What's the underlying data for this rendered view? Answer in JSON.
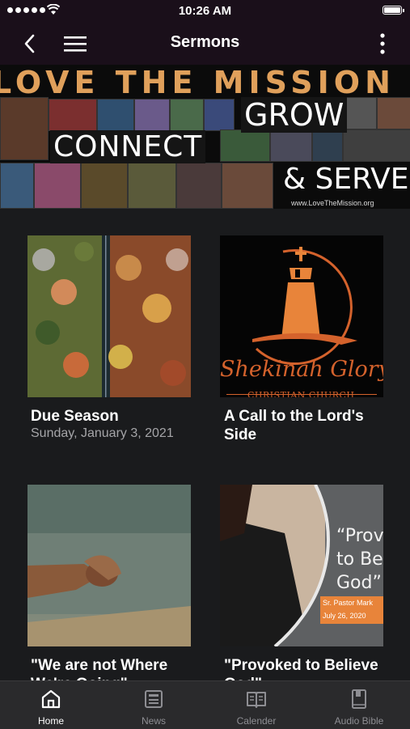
{
  "status_bar": {
    "time": "10:26 AM"
  },
  "nav": {
    "title": "Sermons"
  },
  "banner": {
    "headline": "LOVE THE MISSION",
    "word_grow": "GROW",
    "word_connect": "CONNECT",
    "word_serve": "& SERVE",
    "url": "www.LoveTheMission.org"
  },
  "sermons": [
    {
      "title": "Due Season",
      "date": "Sunday, January 3, 2021"
    },
    {
      "title": "A Call to the Lord's Side",
      "date": ""
    },
    {
      "title": "\"We are not Where We're Going\"",
      "date": ""
    },
    {
      "title": "\"Provoked to Believe God\"",
      "date": ""
    }
  ],
  "artwork": {
    "logo_name": "Shekinah Glory",
    "logo_sub": "CHRISTIAN CHURCH",
    "quote": "“Provoked to Believe God”",
    "quote_line1": "“Prov",
    "quote_line2": "to Be",
    "quote_line3": "God”",
    "preacher": "Sr. Pastor Mark",
    "preach_date": "July 26, 2020"
  },
  "tabs": [
    {
      "label": "Home",
      "icon": "home-icon"
    },
    {
      "label": "News",
      "icon": "news-icon"
    },
    {
      "label": "Calender",
      "icon": "calendar-book-icon"
    },
    {
      "label": "Audio Bible",
      "icon": "bible-icon"
    }
  ],
  "colors": {
    "header_bg": "#1a0f1a",
    "body_bg": "#1a1b1d",
    "accent_orange": "#d4622c"
  }
}
